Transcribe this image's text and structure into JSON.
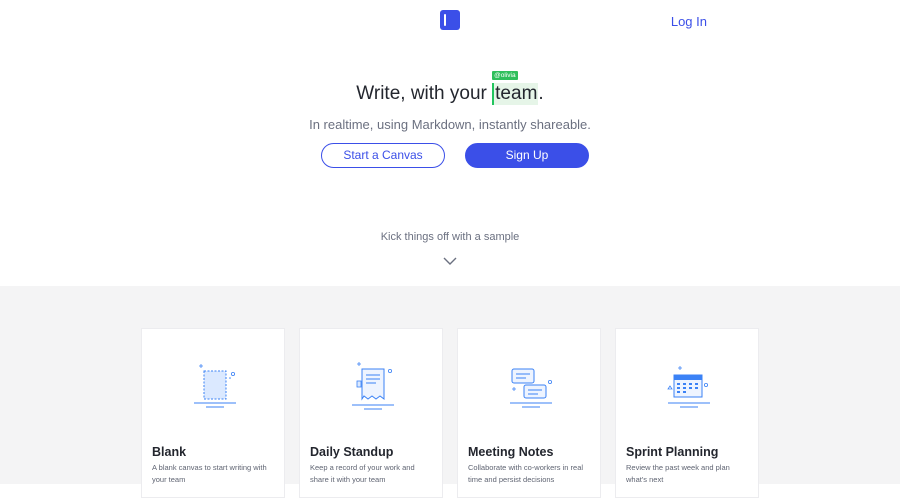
{
  "header": {
    "login_label": "Log In"
  },
  "hero": {
    "headline_prefix": "Write, with your",
    "headline_word": "team",
    "headline_suffix": ".",
    "cursor_user": "@olivia",
    "subtitle": "In realtime, using Markdown, instantly shareable.",
    "start_canvas_label": "Start a Canvas",
    "signup_label": "Sign Up",
    "kick_text": "Kick things off with a sample"
  },
  "samples": [
    {
      "title": "Blank",
      "description": "A blank canvas to start writing with your team",
      "icon": "blank-canvas-icon"
    },
    {
      "title": "Daily Standup",
      "description": "Keep a record of your work and share it with your team",
      "icon": "document-icon"
    },
    {
      "title": "Meeting Notes",
      "description": "Collaborate with co-workers in real time and persist decisions",
      "icon": "chat-bubbles-icon"
    },
    {
      "title": "Sprint Planning",
      "description": "Review the past week and plan what's next",
      "icon": "calendar-icon"
    }
  ],
  "colors": {
    "accent": "#3b4fe8",
    "cursor_green": "#2fbf5b",
    "section_bg": "#f4f4f5"
  }
}
